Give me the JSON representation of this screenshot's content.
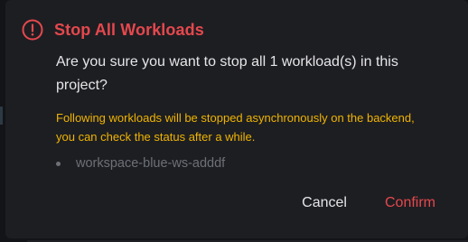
{
  "dialog": {
    "title": "Stop All Workloads",
    "question": "Are you sure you want to stop all 1 workload(s) in this project?",
    "warning": "Following workloads will be stopped asynchronously on the backend, you can check the status after a while.",
    "workloads": [
      "workspace-blue-ws-adddf"
    ],
    "icon": "alert-circle-icon",
    "cancel_label": "Cancel",
    "confirm_label": "Confirm"
  },
  "colors": {
    "danger": "#e5484d",
    "warning": "#f0b400",
    "text": "#e6e6e8",
    "muted": "#6e7078",
    "dialog_bg": "#1d1e22"
  }
}
